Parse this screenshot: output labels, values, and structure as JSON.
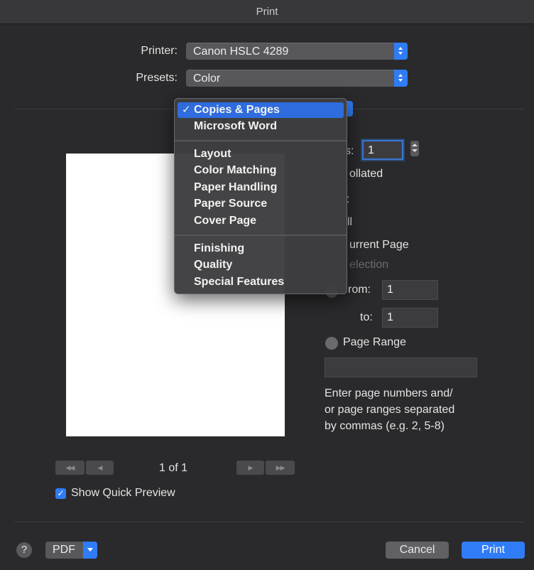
{
  "window": {
    "title": "Print"
  },
  "printer": {
    "label": "Printer:",
    "value": "Canon HSLC 4289"
  },
  "presets": {
    "label": "Presets:",
    "value": "Color"
  },
  "menu": {
    "checkmark": "✓",
    "items": [
      "Copies & Pages",
      "Microsoft Word",
      "Layout",
      "Color Matching",
      "Paper Handling",
      "Paper Source",
      "Cover Page",
      "Finishing",
      "Quality",
      "Special Features"
    ],
    "selected": "Copies & Pages"
  },
  "copies": {
    "label_partial": "s:",
    "value": "1",
    "collated_partial": "ollated"
  },
  "pages": {
    "label_partial": ":",
    "all_partial": "ll",
    "current_partial": "urrent Page",
    "selection_partial": "election",
    "from_partial": "rom:",
    "from_value": "1",
    "to_label": "to:",
    "to_value": "1",
    "range_label": "Page Range",
    "range_value": "",
    "help_line1": "Enter page numbers and/",
    "help_line2": "or page ranges separated",
    "help_line3": "by commas (e.g. 2, 5-8)"
  },
  "preview_nav": {
    "first": "◀◀",
    "prev": "◀",
    "next": "▶",
    "last": "▶▶",
    "page_indicator": "1 of 1"
  },
  "show_quick_preview": {
    "label": "Show Quick Preview",
    "checked": true
  },
  "footer": {
    "help": "?",
    "pdf": "PDF",
    "cancel": "Cancel",
    "print": "Print"
  },
  "colors": {
    "accent": "#2f7cf6",
    "menu_selection": "#2f6cdd",
    "window": "#2a2a2c"
  }
}
